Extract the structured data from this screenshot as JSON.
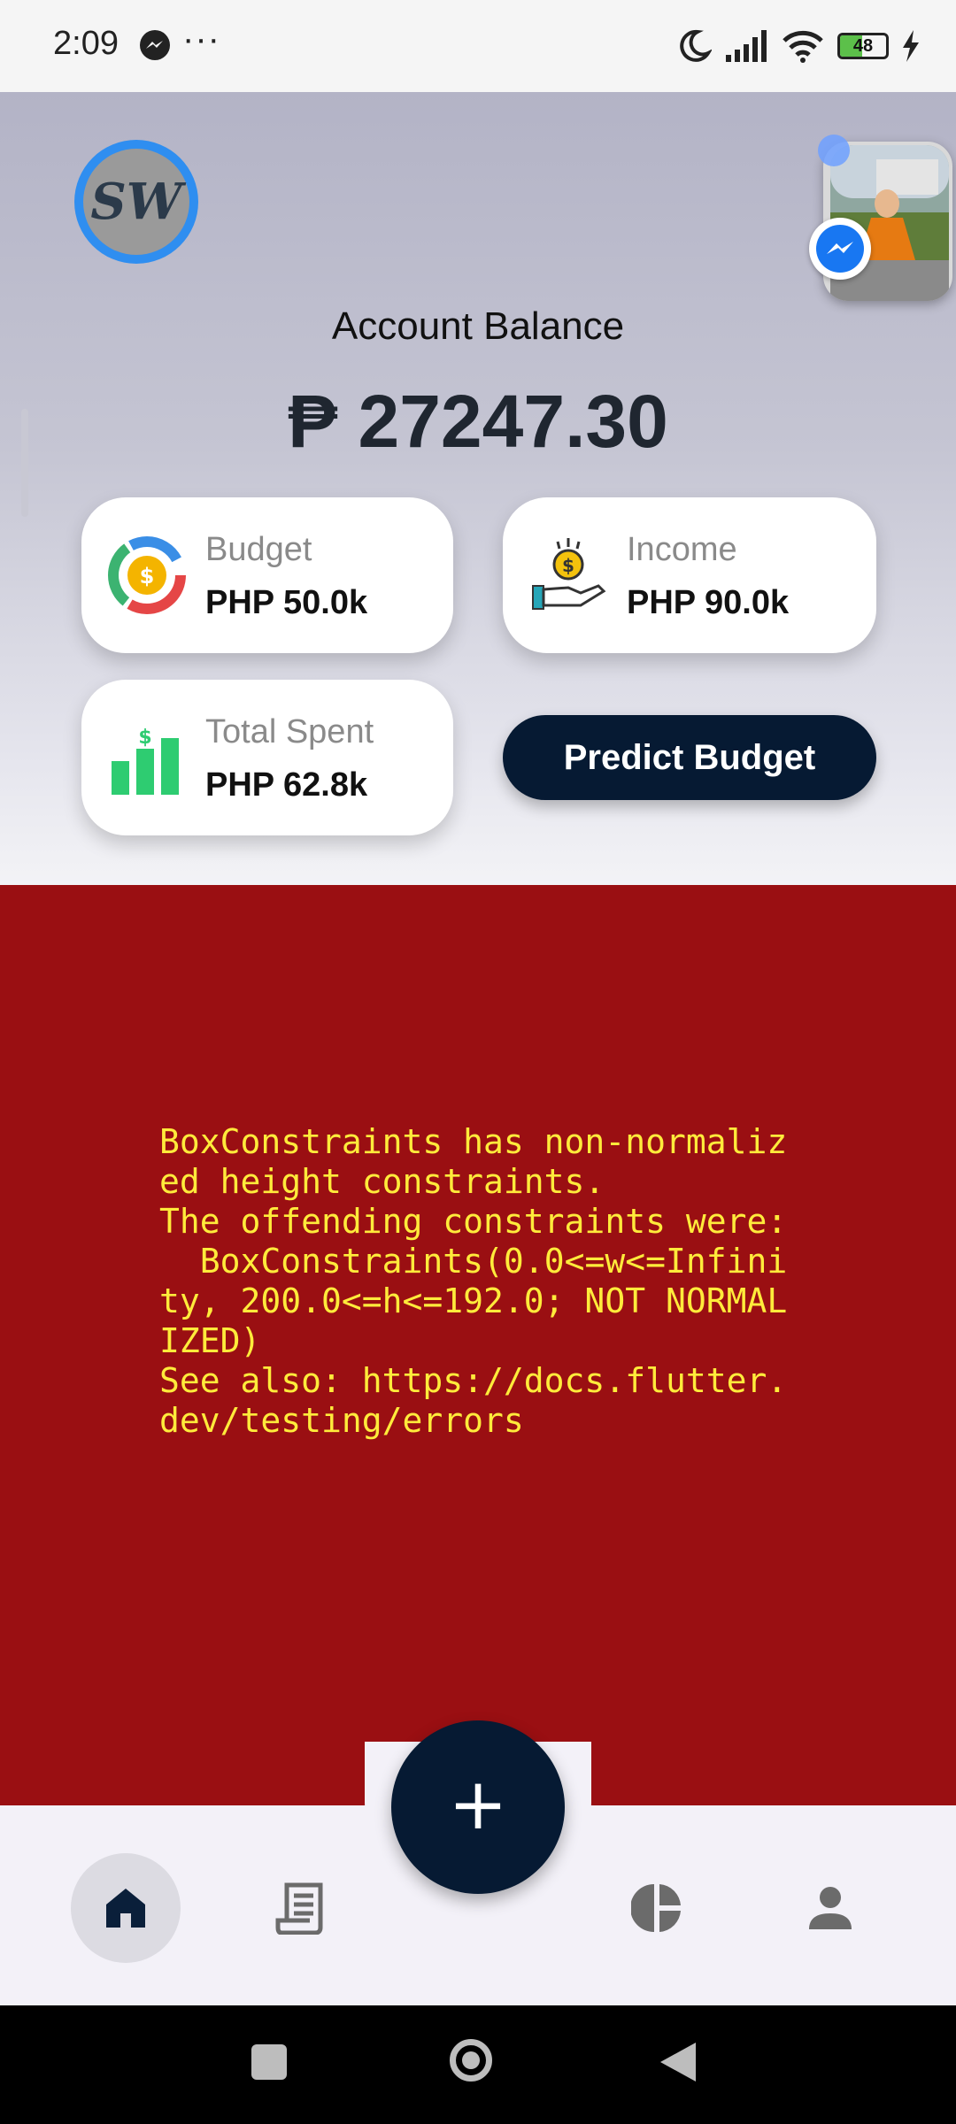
{
  "status_bar": {
    "time": "2:09",
    "more": "···",
    "battery_level": "48"
  },
  "header": {
    "logo_text": "SW",
    "balance_label": "Account Balance",
    "balance_value": "₱ 27247.30"
  },
  "cards": {
    "budget": {
      "title": "Budget",
      "value": "PHP 50.0k"
    },
    "income": {
      "title": "Income",
      "value": "PHP 90.0k"
    },
    "total_spent": {
      "title": "Total Spent",
      "value": "PHP 62.8k"
    }
  },
  "predict_button": {
    "label": "Predict Budget"
  },
  "error": {
    "message": "BoxConstraints has non-normalized height constraints.\nThe offending constraints were:\n  BoxConstraints(0.0<=w<=Infinity, 200.0<=h<=192.0; NOT NORMALIZED)\nSee also: https://docs.flutter.dev/testing/errors"
  },
  "fab": {
    "label": "+"
  },
  "colors": {
    "primary_dark": "#061a33",
    "error_background": "#9a0f12",
    "error_text": "#ffeb3b",
    "nav_background": "#f3f1f8",
    "logo_ring": "#2f8ef0"
  },
  "icons": {
    "status": [
      "messenger-icon",
      "moon-icon",
      "signal-icon",
      "wifi-icon",
      "battery-icon",
      "charging-icon"
    ],
    "nav": [
      "home-icon",
      "receipt-icon",
      "pie-chart-icon",
      "person-icon"
    ],
    "system_nav": [
      "recents-square-icon",
      "home-circle-icon",
      "back-triangle-icon"
    ]
  }
}
